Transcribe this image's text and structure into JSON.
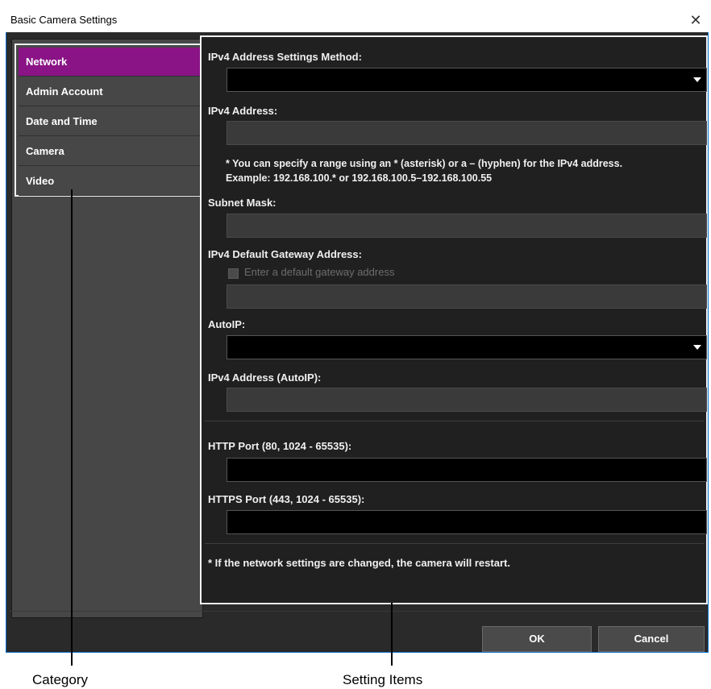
{
  "window": {
    "title": "Basic Camera Settings",
    "close_glyph": "✕"
  },
  "categories": [
    {
      "label": "Network",
      "selected": true
    },
    {
      "label": "Admin Account",
      "selected": false
    },
    {
      "label": "Date and Time",
      "selected": false
    },
    {
      "label": "Camera",
      "selected": false
    },
    {
      "label": "Video",
      "selected": false
    }
  ],
  "settings": {
    "ipv4_method_label": "IPv4 Address Settings Method:",
    "ipv4_method_value": "",
    "ipv4_address_label": "IPv4 Address:",
    "ipv4_address_value": "",
    "ipv4_note_line1": "* You can specify a range using an * (asterisk) or a – (hyphen) for the IPv4 address.",
    "ipv4_note_line2": "Example: 192.168.100.* or 192.168.100.5–192.168.100.55",
    "subnet_label": "Subnet Mask:",
    "subnet_value": "",
    "gateway_label": "IPv4 Default Gateway Address:",
    "gateway_checkbox_label": "Enter a default gateway address",
    "gateway_checked": false,
    "gateway_value": "",
    "autoip_label": "AutoIP:",
    "autoip_value": "",
    "autoip_address_label": "IPv4 Address (AutoIP):",
    "autoip_address_value": "",
    "http_port_label": "HTTP Port (80, 1024 - 65535):",
    "http_port_value": "",
    "https_port_label": "HTTPS Port (443, 1024 - 65535):",
    "https_port_value": "",
    "restart_note": "* If the network settings are changed, the camera will restart."
  },
  "buttons": {
    "ok": "OK",
    "cancel": "Cancel"
  },
  "callouts": {
    "category": "Category",
    "setting_items": "Setting Items"
  },
  "colors": {
    "selected_category": "#8a1485",
    "window_border": "#0b6fcf",
    "panel_bg": "#202020"
  }
}
